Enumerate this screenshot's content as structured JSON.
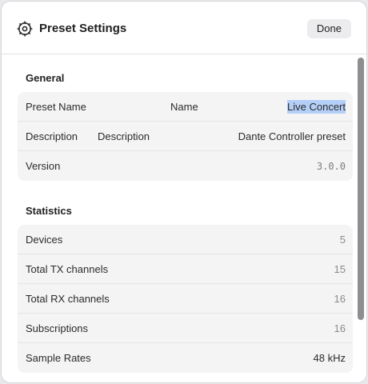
{
  "window": {
    "title": "Preset Settings",
    "done_label": "Done",
    "icon": "gear-icon"
  },
  "general": {
    "title": "General",
    "preset_name": {
      "label": "Preset Name",
      "field_label": "Name",
      "value": "Live Concert"
    },
    "description": {
      "label": "Description",
      "field_label": "Description",
      "value": "Dante Controller preset"
    },
    "version": {
      "label": "Version",
      "value": "3.0.0"
    }
  },
  "statistics": {
    "title": "Statistics",
    "rows": [
      {
        "label": "Devices",
        "value": "5"
      },
      {
        "label": "Total TX channels",
        "value": "15"
      },
      {
        "label": "Total RX channels",
        "value": "16"
      },
      {
        "label": "Subscriptions",
        "value": "16"
      },
      {
        "label": "Sample Rates",
        "value": "48 kHz"
      }
    ]
  },
  "colors": {
    "selection_highlight": "#b4cff7",
    "card_background": "#f4f4f5",
    "scrollbar": "#8e8e91"
  }
}
